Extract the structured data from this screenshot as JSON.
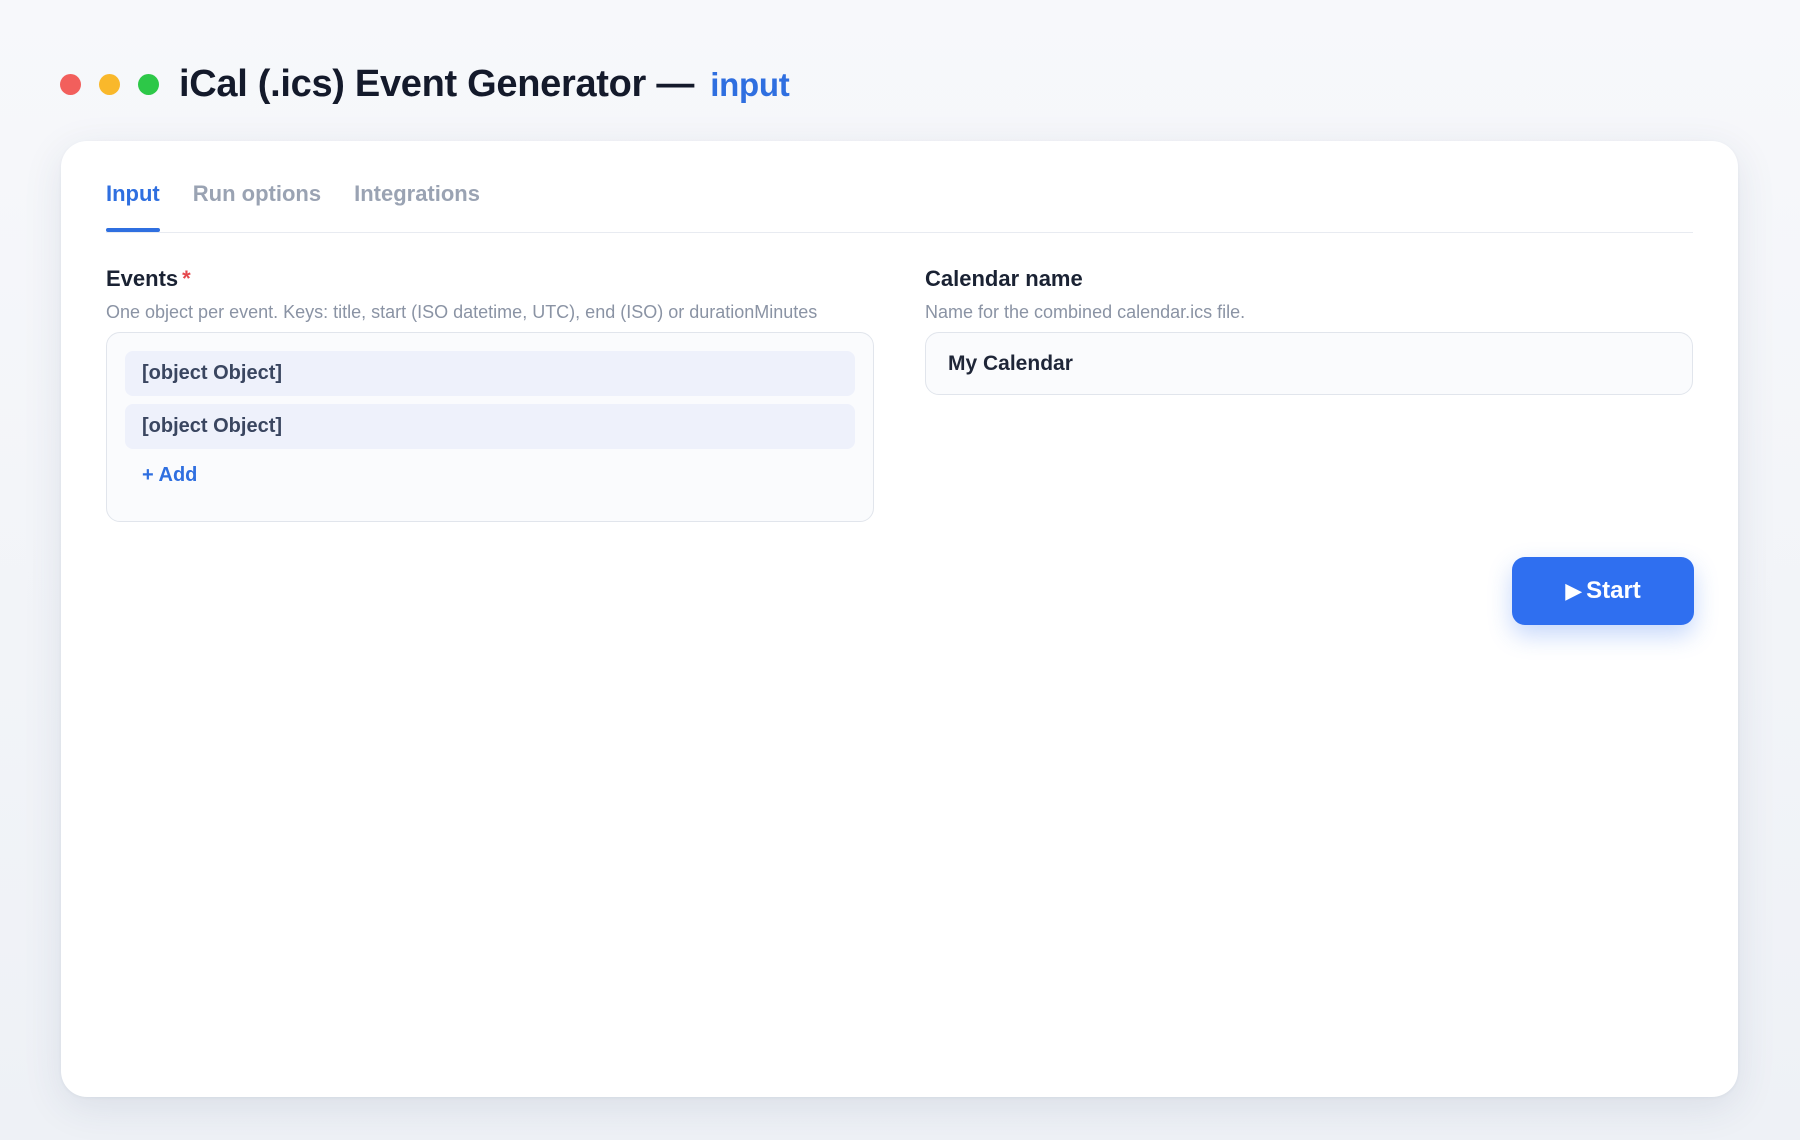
{
  "window": {
    "title": "iCal (.ics) Event Generator",
    "separator": "—",
    "mode": "input",
    "controls": {
      "close_color": "#f25f5c",
      "minimize_color": "#f9b82b",
      "maximize_color": "#2dc848"
    }
  },
  "tabs": [
    {
      "label": "Input",
      "active": true
    },
    {
      "label": "Run options",
      "active": false
    },
    {
      "label": "Integrations",
      "active": false
    }
  ],
  "events_field": {
    "label": "Events",
    "required_marker": "*",
    "help": "One object per event. Keys: title, start (ISO datetime, UTC), end (ISO) or durationMinutes",
    "items": [
      "[object Object]",
      "[object Object]"
    ],
    "add_label": "+ Add"
  },
  "calendar_field": {
    "label": "Calendar name",
    "help": "Name for the combined calendar.ics file.",
    "value": "My Calendar"
  },
  "start_button": {
    "icon": "play-icon",
    "icon_glyph": "▶",
    "label": "Start"
  },
  "colors": {
    "accent": "#2f6fe0",
    "button": "#2f6ff0",
    "required": "#e5484d"
  }
}
